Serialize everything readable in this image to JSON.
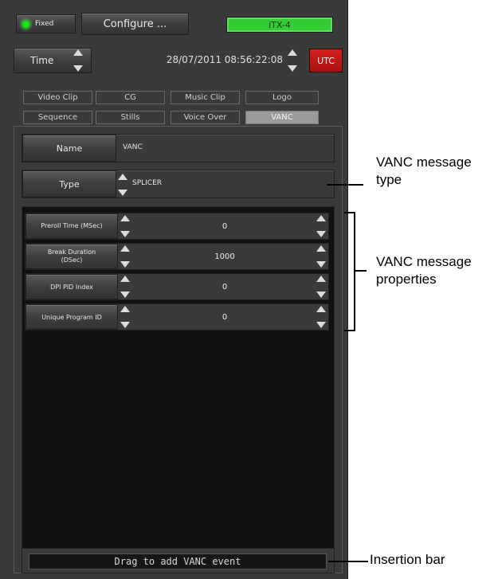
{
  "toolbar": {
    "fixed_label": "Fixed",
    "configure_label": "Configure ...",
    "device_label": "iTX-4",
    "fixed_led_color": "#22dd22",
    "device_color": "#33cc33"
  },
  "time": {
    "time_label": "Time",
    "datetime": "28/07/2011 08:56:22:08",
    "utc_label": "UTC",
    "utc_color": "#c41818"
  },
  "tabs_row1": [
    "Video Clip",
    "CG",
    "Music Clip",
    "Logo"
  ],
  "tabs_row2": [
    "Sequence",
    "Stills",
    "Voice Over",
    "VANC"
  ],
  "active_tab": "VANC",
  "name_row": {
    "label": "Name",
    "value": "VANC"
  },
  "type_row": {
    "label": "Type",
    "value": "SPLICER"
  },
  "properties": [
    {
      "label": "Preroll Time (MSec)",
      "value": "0"
    },
    {
      "label": "Break Duration (DSec)",
      "value": "1000"
    },
    {
      "label": "DPI PID Index",
      "value": "0"
    },
    {
      "label": "Unique Program ID",
      "value": "0"
    }
  ],
  "insertion_bar": {
    "label": "Drag to add VANC event"
  },
  "callouts": {
    "message_type": "VANC message type",
    "message_properties": "VANC message properties",
    "insertion_bar": "Insertion bar"
  }
}
